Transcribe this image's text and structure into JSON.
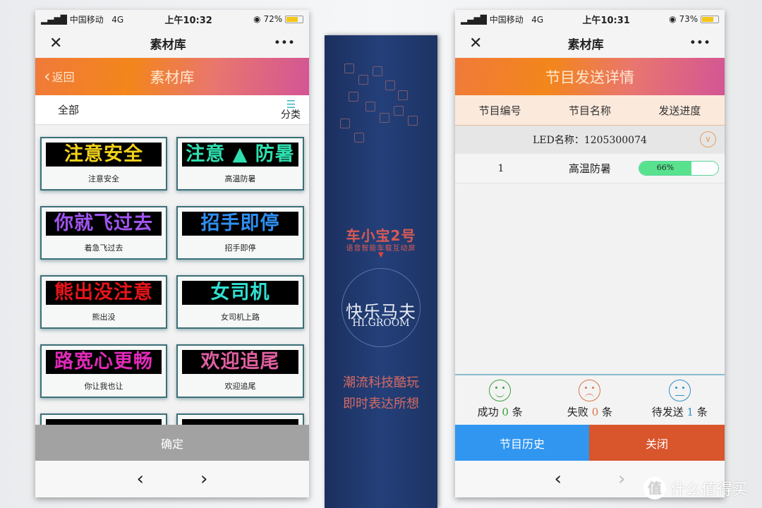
{
  "left_phone": {
    "status": {
      "carrier": "中国移动",
      "network": "4G",
      "time": "上午10:32",
      "battery": "72%",
      "battery_level": 72
    },
    "title": "素材库",
    "close_icon": "close-icon",
    "more": "•••",
    "banner": {
      "back": "返回",
      "title": "素材库"
    },
    "filter": {
      "all": "全部",
      "category": "分类"
    },
    "cards": [
      {
        "led": "注意安全",
        "color": "#f2d21a",
        "label": "注意安全"
      },
      {
        "led": "注意 ▲ 防暑",
        "color": "#2ee0b0",
        "label": "高温防暑"
      },
      {
        "led": "你就飞过去",
        "color": "#a155f0",
        "label": "着急飞过去"
      },
      {
        "led": "招手即停",
        "color": "#2f8ff0",
        "label": "招手即停"
      },
      {
        "led": "熊出没注意",
        "color": "#e8141a",
        "label": "熊出没"
      },
      {
        "led": "女司机",
        "color": "#2fe0d0",
        "label": "女司机上路"
      },
      {
        "led": "路宽心更畅",
        "color": "#e02ab8",
        "label": "你让我也让"
      },
      {
        "led": "欢迎追尾",
        "color": "#e060a0",
        "label": "欢迎追尾"
      },
      {
        "led": "",
        "color": "#e8141a",
        "label": ""
      },
      {
        "led": "",
        "color": "#2ee02e",
        "label": ""
      }
    ],
    "confirm": "确定",
    "nav_prev": "‹",
    "nav_next": "›"
  },
  "box": {
    "product": "车小宝2号",
    "subtitle": "语音智能车载互动屏",
    "brand_cn": "快乐马夫",
    "brand_en": "HI.GROOM",
    "slogan1": "潮流科技酷玩",
    "slogan2": "即时表达所想"
  },
  "right_phone": {
    "status": {
      "carrier": "中国移动",
      "network": "4G",
      "time": "上午10:31",
      "battery": "73%",
      "battery_level": 73
    },
    "title": "素材库",
    "more": "•••",
    "banner": {
      "title": "节目发送详情"
    },
    "columns": [
      "节目编号",
      "节目名称",
      "发送进度"
    ],
    "led": {
      "label": "LED名称：1205300074"
    },
    "rows": [
      {
        "no": "1",
        "name": "高温防暑",
        "progress": "66%",
        "progress_value": 66
      }
    ],
    "stats": [
      {
        "label": "成功",
        "count": "0",
        "unit": "条",
        "color": "#3aa13a",
        "face": "happy"
      },
      {
        "label": "失败",
        "count": "0",
        "unit": "条",
        "color": "#d9754a",
        "face": "sad"
      },
      {
        "label": "待发送",
        "count": "1",
        "unit": "条",
        "color": "#2e8fc8",
        "face": "neutral"
      }
    ],
    "buttons": {
      "history": "节目历史",
      "close": "关闭",
      "history_color": "#3096f0",
      "close_color": "#d9552c"
    },
    "nav_prev": "‹",
    "nav_next": "›"
  },
  "watermark": {
    "icon": "值",
    "text": "什么值得买"
  }
}
